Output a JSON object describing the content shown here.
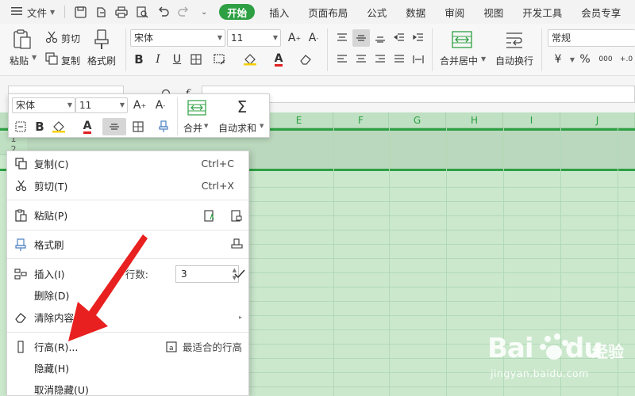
{
  "menubar": {
    "file_label": "文件",
    "tabs": [
      {
        "label": "开始",
        "active": true
      },
      {
        "label": "插入"
      },
      {
        "label": "页面布局"
      },
      {
        "label": "公式"
      },
      {
        "label": "数据"
      },
      {
        "label": "审阅"
      },
      {
        "label": "视图"
      },
      {
        "label": "开发工具"
      },
      {
        "label": "会员专享"
      }
    ]
  },
  "ribbon": {
    "paste": "粘贴",
    "cut": "剪切",
    "copy": "复制",
    "format_painter": "格式刷",
    "font_name": "宋体",
    "font_size": "11",
    "merge_center": "合并居中",
    "wrap_text": "自动换行",
    "number_format": "常规"
  },
  "mini_toolbar": {
    "font_name": "宋体",
    "font_size": "11",
    "merge": "合并",
    "autosum": "自动求和"
  },
  "grid": {
    "columns": [
      "E",
      "F",
      "G",
      "H",
      "I",
      "J"
    ],
    "rows": [
      "1",
      "2"
    ]
  },
  "context_menu": {
    "copy": {
      "label": "复制(C)",
      "shortcut": "Ctrl+C"
    },
    "cut": {
      "label": "剪切(T)",
      "shortcut": "Ctrl+X"
    },
    "paste": {
      "label": "粘贴(P)"
    },
    "format_painter": {
      "label": "格式刷"
    },
    "insert": {
      "label": "插入(I)",
      "rows_label": "行数:",
      "rows_value": "3"
    },
    "delete": {
      "label": "删除(D)"
    },
    "clear": {
      "label": "清除内容(N)"
    },
    "row_height": {
      "label": "行高(R)...",
      "best_fit": "最适合的行高"
    },
    "hide": {
      "label": "隐藏(H)"
    },
    "unhide": {
      "label": "取消隐藏(U)"
    }
  },
  "watermark": {
    "brand": "Bai",
    "brand_cn": "经验",
    "url": "jingyan.baidu.com"
  },
  "colors": {
    "accent": "#2ea043",
    "annotation_arrow": "#e8201f"
  }
}
